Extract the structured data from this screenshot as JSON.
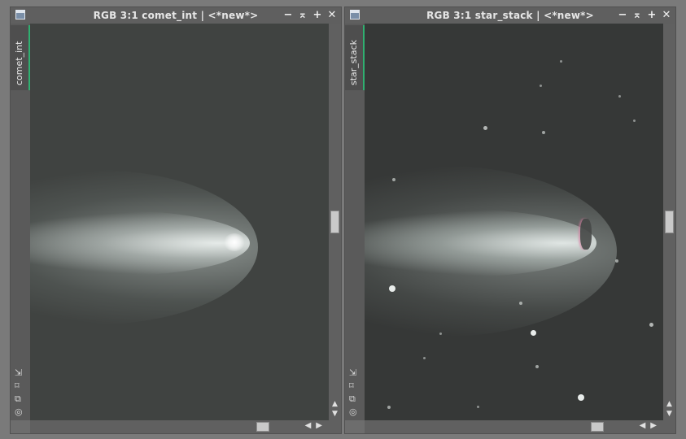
{
  "windows": [
    {
      "title": "RGB 3:1 comet_int | <*new*>",
      "sidebar_tab": "comet_int"
    },
    {
      "title": "RGB 3:1 star_stack | <*new*>",
      "sidebar_tab": "star_stack"
    }
  ],
  "controls": {
    "minimize": "−",
    "shade": "⌅",
    "maximize": "+",
    "close": "✕"
  },
  "side_icons": {
    "fit": "⇲",
    "zoom": "⌑",
    "clone": "⧉",
    "target": "◎"
  },
  "scroll": {
    "up": "▲",
    "down": "▼",
    "left": "◀",
    "right": "▶"
  },
  "colors": {
    "titlebar": "#5f5f5f",
    "frame": "#6d6d6d",
    "sidetab_accent": "#2fb070",
    "sky_left": "#3f4240",
    "sky_right": "#353736"
  }
}
